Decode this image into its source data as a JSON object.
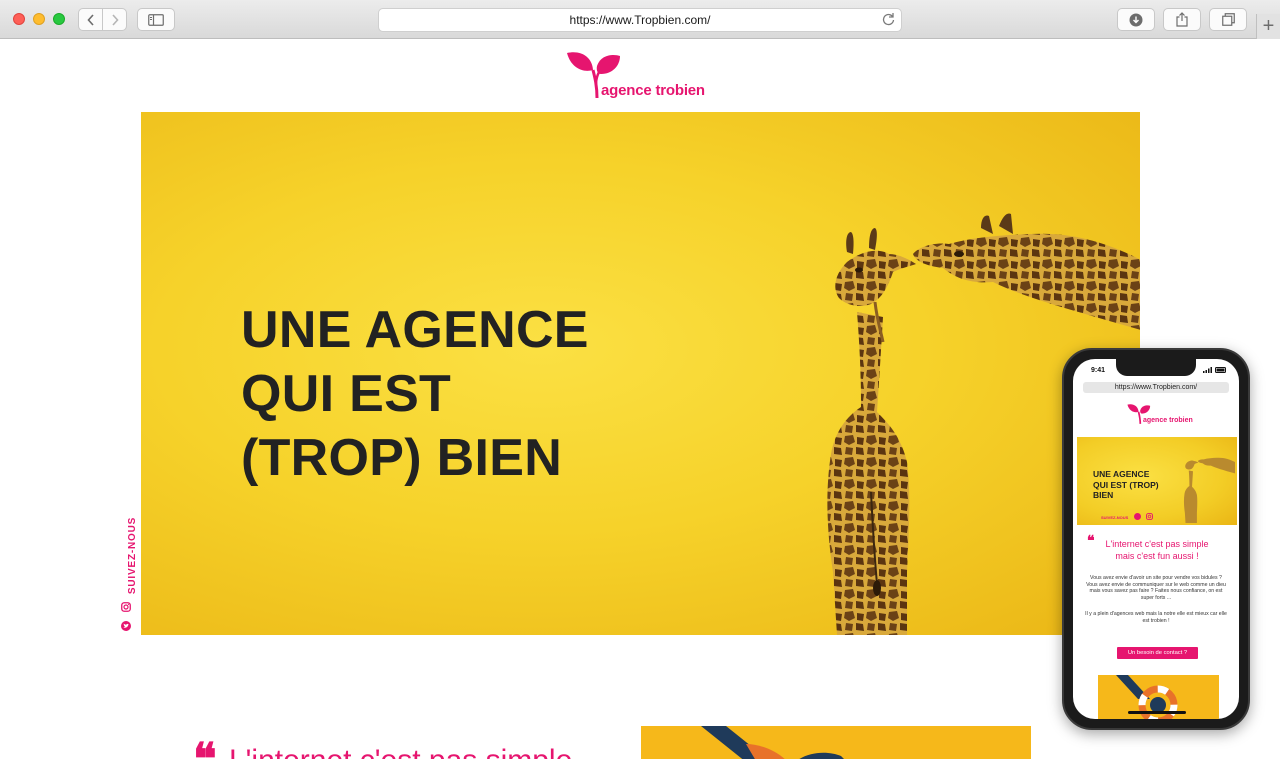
{
  "browser": {
    "url": "https://www.Tropbien.com/",
    "icons": [
      "back-arrow-icon",
      "forward-arrow-icon",
      "sidebar-icon",
      "reload-icon",
      "download-icon",
      "share-icon",
      "tabs-icon",
      "plus-icon"
    ],
    "new_tab": "+"
  },
  "brand": {
    "name": "agence trobien",
    "color": "#e6156f"
  },
  "hero": {
    "title": "UNE AGENCE\nQUI EST\n(TROP) BIEN",
    "background": "#f6d22a"
  },
  "social": {
    "label": "SUIVEZ-NOUS",
    "icons": [
      "instagram-icon",
      "twitter-icon"
    ]
  },
  "intro": {
    "quote_mark": "❝",
    "heading": "L'internet c'est pas simple"
  },
  "phone": {
    "time": "9:41",
    "url": "https://www.Tropbien.com/",
    "logo": "agence trobien",
    "hero_title": "UNE AGENCE\nQUI EST (TROP)\nBIEN",
    "follow": "SUIVEZ-NOUS",
    "quote_mark": "❝",
    "heading": "L'internet c'est pas simple\nmais c'est fun aussi !",
    "body1": "Vous avez envie d'avoir un site pour vendre vos bidules ? Vous avez envie de communiquer sur le web comme un dieu mais vous savez pas faire ? Faites nous confiance, on est super forts ...",
    "body2": "Il y a plein d'agences web mais la notre elle est mieux car elle est trobien !",
    "cta": "Un besoin de contact ?"
  }
}
